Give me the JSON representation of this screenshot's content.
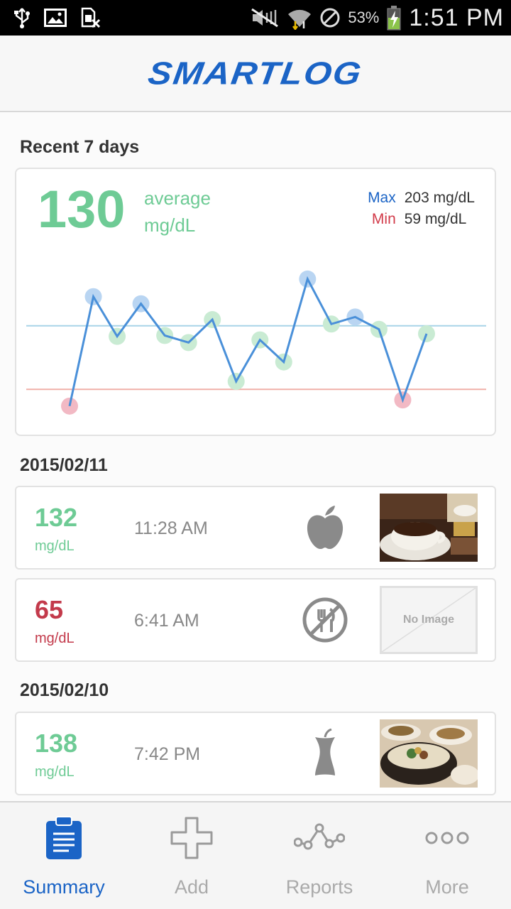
{
  "status_bar": {
    "battery_percent": "53%",
    "time": "1:51 PM",
    "icons_left": [
      "usb-icon",
      "image-icon",
      "sim-off-icon"
    ],
    "icons_right": [
      "mute-icon",
      "wifi-icon",
      "no-sync-icon",
      "battery-icon"
    ]
  },
  "header": {
    "logo": "SMARTLOG",
    "logo_color": "#1b64c6"
  },
  "summary": {
    "title": "Recent 7 days",
    "average_value": "130",
    "average_label": "average",
    "average_unit": "mg/dL",
    "max_label": "Max",
    "max_value": "203 mg/dL",
    "min_label": "Min",
    "min_value": "59 mg/dL",
    "accent_green": "#6ecb95",
    "max_color": "#1b64c6",
    "min_color": "#d23b4a"
  },
  "chart_data": {
    "type": "line",
    "values": [
      59,
      183,
      138,
      175,
      139,
      131,
      157,
      87,
      134,
      109,
      203,
      152,
      160,
      146,
      66,
      141
    ],
    "point_status": [
      "low",
      "high",
      "normal",
      "high",
      "normal",
      "normal",
      "normal",
      "normal",
      "normal",
      "normal",
      "high",
      "normal",
      "high",
      "normal",
      "low",
      "normal"
    ],
    "reference_lines": [
      {
        "kind": "upper",
        "value": 150,
        "color": "#a8d4e8"
      },
      {
        "kind": "lower",
        "value": 78,
        "color": "#f0b0a8"
      }
    ],
    "ylim": [
      50,
      215
    ],
    "grid": false,
    "colors": {
      "line": "#4a90d9",
      "high": "#b9d5f2",
      "normal": "#c9ebd3",
      "low": "#f2b9c4"
    }
  },
  "days": [
    {
      "date": "2015/02/11",
      "entries": [
        {
          "value": "132",
          "unit": "mg/dL",
          "status": "normal",
          "time": "11:28 AM",
          "meal_icon": "apple-icon",
          "photo": "coffee-photo"
        },
        {
          "value": "65",
          "unit": "mg/dL",
          "status": "low",
          "time": "6:41 AM",
          "meal_icon": "fasting-icon",
          "photo": "no-image",
          "no_image_text": "No Image"
        }
      ]
    },
    {
      "date": "2015/02/10",
      "entries": [
        {
          "value": "138",
          "unit": "mg/dL",
          "status": "normal",
          "time": "7:42 PM",
          "meal_icon": "apple-core-icon",
          "photo": "food-photo"
        }
      ]
    }
  ],
  "nav": [
    {
      "label": "Summary",
      "icon": "clipboard-icon",
      "active": true
    },
    {
      "label": "Add",
      "icon": "plus-icon",
      "active": false
    },
    {
      "label": "Reports",
      "icon": "reports-icon",
      "active": false
    },
    {
      "label": "More",
      "icon": "more-icon",
      "active": false
    }
  ]
}
